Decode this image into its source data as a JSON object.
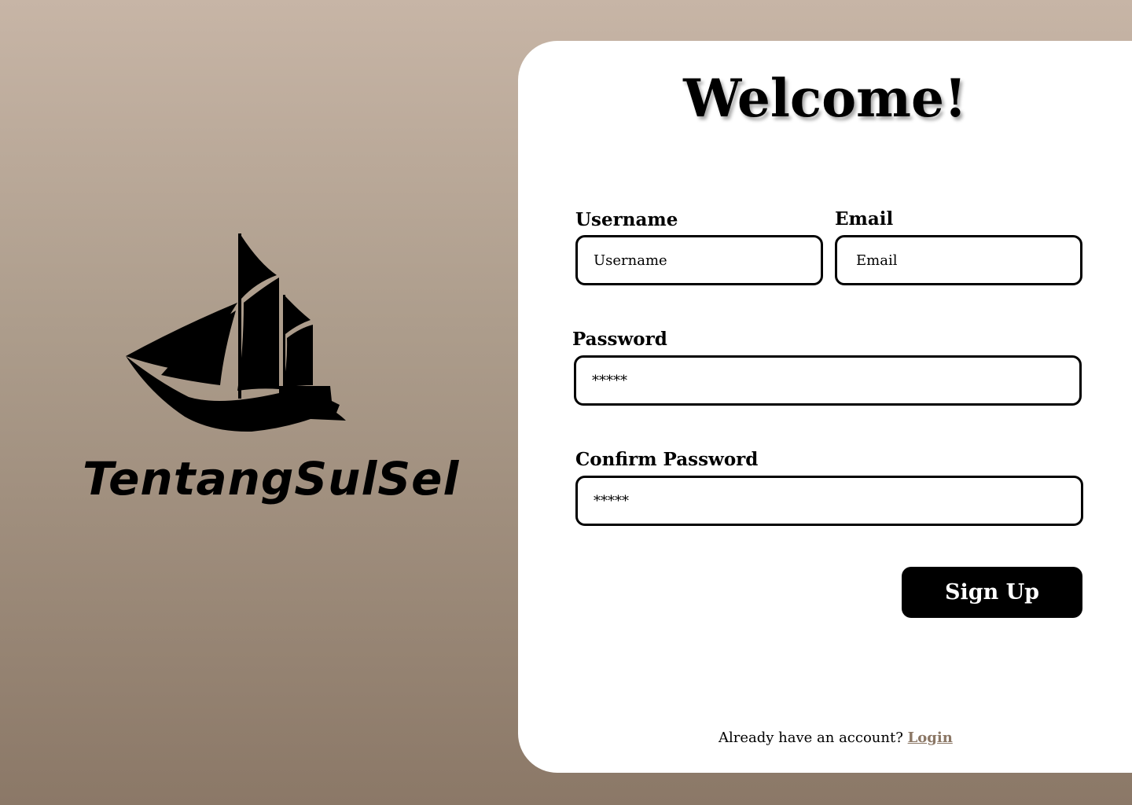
{
  "brand": {
    "name": "TentangSulSel",
    "logo_icon": "sailing-ship-icon"
  },
  "form": {
    "title": "Welcome!",
    "username": {
      "label": "Username",
      "placeholder": "Username",
      "value": ""
    },
    "email": {
      "label": "Email",
      "placeholder": "Email",
      "value": ""
    },
    "password": {
      "label": "Password",
      "placeholder": "*****",
      "value": ""
    },
    "confirm_password": {
      "label": "Confirm Password",
      "placeholder": "*****",
      "value": ""
    },
    "submit_label": "Sign Up"
  },
  "footer": {
    "prompt": "Already have an account?",
    "link_label": "Login"
  },
  "colors": {
    "background_top": "#c7b5a6",
    "background_bottom": "#8b7867",
    "card": "#ffffff",
    "button": "#000000",
    "link": "#8b7765"
  }
}
